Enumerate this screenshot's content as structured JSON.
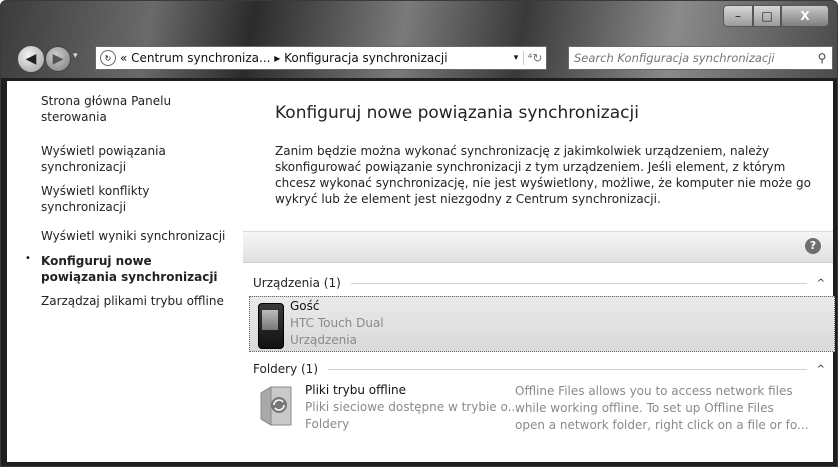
{
  "window": {
    "minimize_glyph": "–",
    "maximize_glyph": "□",
    "close_glyph": "X"
  },
  "nav": {
    "back_glyph": "◀",
    "forward_glyph": "▶",
    "recent_glyph": "▾",
    "address": "« Centrum synchroniza... ▸ Konfiguracja synchronizacji",
    "address_dropdown_glyph": "▾",
    "refresh_glyph": "⁴↻",
    "search_placeholder": "Search Konfiguracja synchronizacji",
    "search_glyph": "⚲"
  },
  "sidebar": {
    "items": [
      {
        "label": "Strona główna Panelu sterowania"
      },
      {
        "label": "Wyświetl powiązania synchronizacji"
      },
      {
        "label": "Wyświetl konflikty synchronizacji"
      },
      {
        "label": "Wyświetl wyniki synchronizacji"
      },
      {
        "label": "Konfiguruj nowe powiązania synchronizacji"
      },
      {
        "label": "Zarządzaj plikami trybu offline"
      }
    ],
    "bullet": "•"
  },
  "main": {
    "title": "Konfiguruj nowe powiązania synchronizacji",
    "description": "Zanim będzie można wykonać synchronizację z jakimkolwiek urządzeniem, należy skonfigurować powiązanie synchronizacji z tym urządzeniem. Jeśli element, z którym chcesz wykonać synchronizację, nie jest wyświetlony, możliwe, że komputer nie może go wykryć lub że element jest niezgodny z Centrum synchronizacji.",
    "help_glyph": "?",
    "groups": {
      "devices": {
        "header": "Urządzenia (1)",
        "chevron": "^",
        "item": {
          "name": "Gość",
          "model": "HTC Touch Dual",
          "category": "Urządzenia"
        }
      },
      "folders": {
        "header": "Foldery (1)",
        "chevron": "^",
        "item": {
          "name": "Pliki trybu offline",
          "subtitle": "Pliki sieciowe dostępne w trybie o...",
          "category": "Foldery",
          "desc_line1": "Offline Files allows you to access network files",
          "desc_line2": "while working offline. To set up Offline Files",
          "desc_line3": "open a network folder, right click on a file or fo..."
        }
      }
    }
  }
}
